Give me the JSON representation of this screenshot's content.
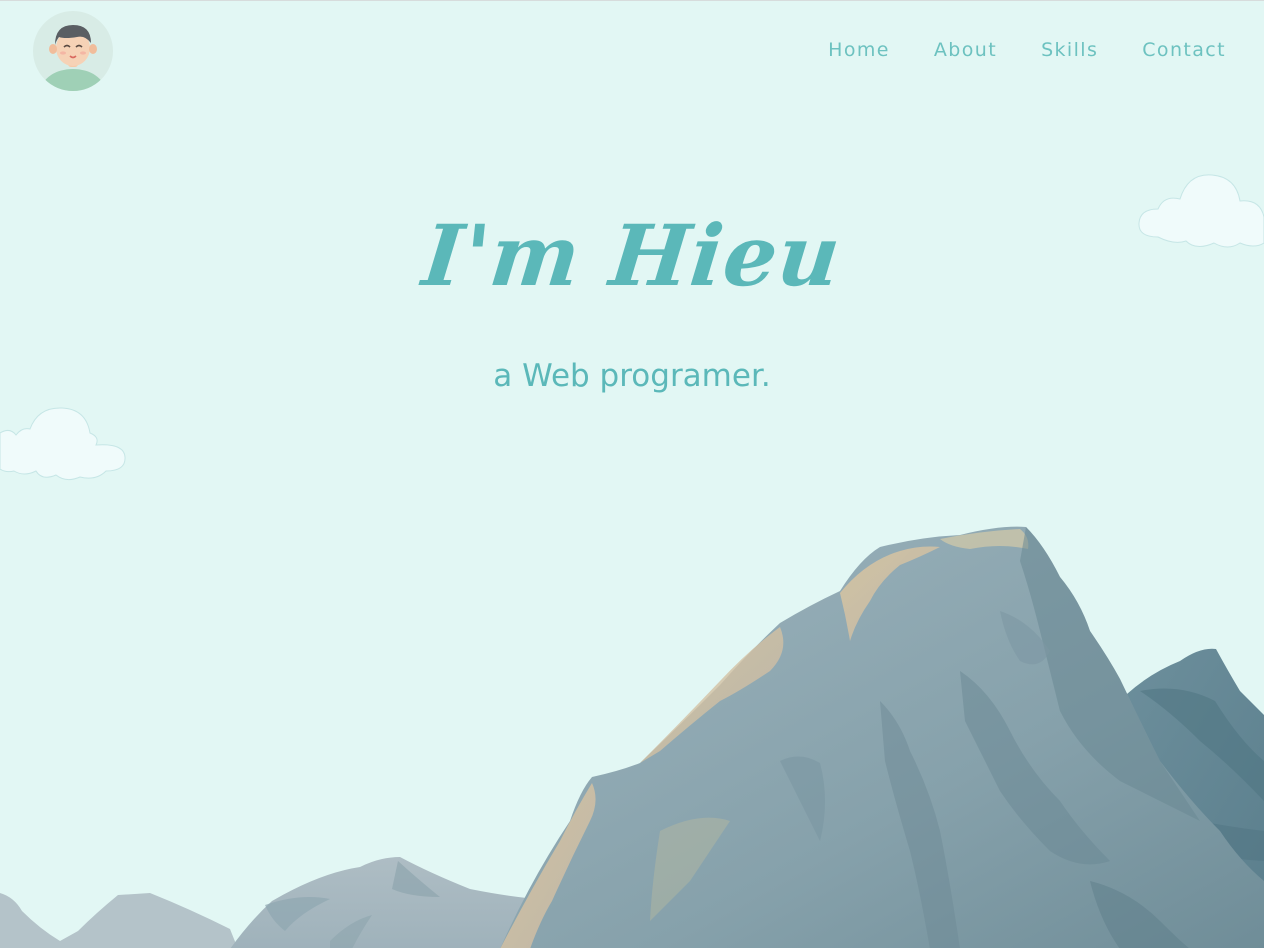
{
  "header": {
    "avatar_icon": "avatar-icon",
    "nav": [
      {
        "label": "Home"
      },
      {
        "label": "About"
      },
      {
        "label": "Skills"
      },
      {
        "label": "Contact"
      }
    ]
  },
  "hero": {
    "title": "I'm Hieu",
    "subtitle": "a Web programer."
  },
  "colors": {
    "background": "#e2f7f4",
    "accent": "#5bb8b9",
    "nav": "#6dc2c0",
    "mountain_main": "#8fa9b3",
    "mountain_dark": "#6b8b97"
  }
}
